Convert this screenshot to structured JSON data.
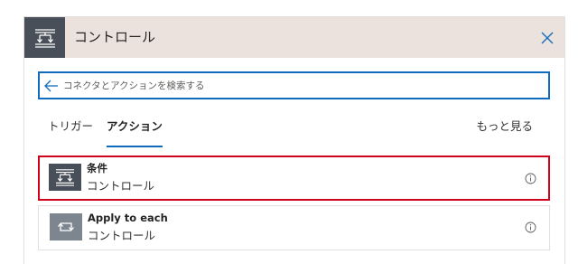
{
  "header": {
    "title": "コントロール",
    "icon": "control-icon",
    "close_icon": "close-icon",
    "background_color": "#ece2dd",
    "icon_background": "#484f58"
  },
  "search": {
    "placeholder": "コネクタとアクションを検索する",
    "value": "",
    "back_icon": "back-arrow-icon",
    "border_color": "#0f6cbd"
  },
  "tabs": [
    {
      "label": "トリガー",
      "selected": false
    },
    {
      "label": "アクション",
      "selected": true
    }
  ],
  "more_label": "もっと見る",
  "list": [
    {
      "title": "条件",
      "subtitle": "コントロール",
      "icon": "condition-icon",
      "info_icon": "info-icon",
      "highlighted": true
    },
    {
      "title": "Apply to each",
      "subtitle": "コントロール",
      "icon": "loop-icon",
      "info_icon": "info-icon",
      "highlighted": false
    }
  ],
  "colors": {
    "accent": "#0f6cbd",
    "highlight_border": "#d0021b"
  }
}
